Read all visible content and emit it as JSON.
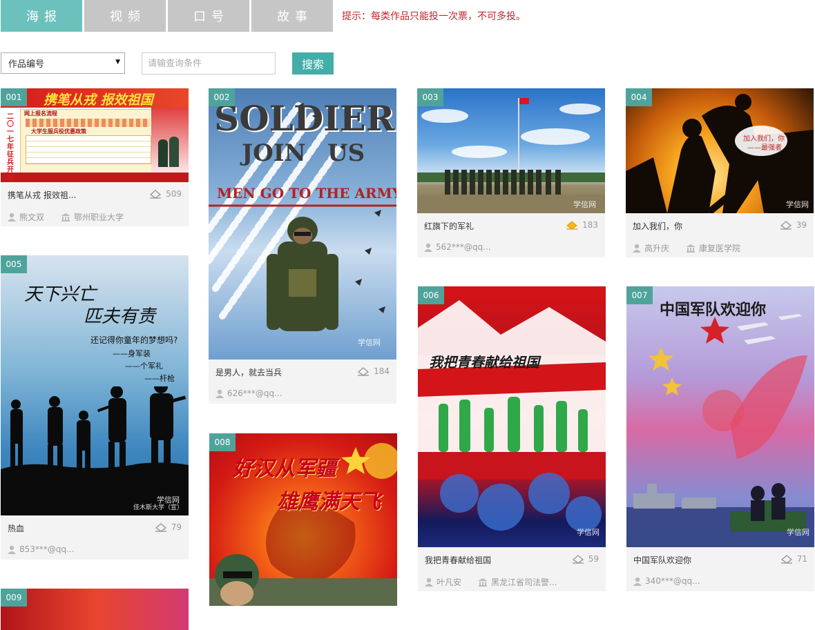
{
  "tabs": [
    {
      "label": "海报",
      "active": true
    },
    {
      "label": "视频",
      "active": false
    },
    {
      "label": "口号",
      "active": false
    },
    {
      "label": "故事",
      "active": false
    }
  ],
  "hint": "提示：每类作品只能投一次票，不可多投。",
  "search": {
    "select_value": "作品编号",
    "placeholder": "请输查询条件",
    "button_label": "搜索"
  },
  "colors": {
    "tab_active": "#6dc1bc",
    "tab_inactive": "#c6c6c6",
    "accent": "#43ada7",
    "hint": "#c0262c",
    "vote_active": "#f2b824"
  },
  "works": [
    {
      "id": "001",
      "title": "携笔从戎 报效祖...",
      "votes": "509",
      "author": "熊文双",
      "school": "鄂州职业大学",
      "poster_text": [
        "携笔从戎 报效祖国",
        "二〇一七年征兵开始了",
        "网上报名流程",
        "大学生服兵役优惠政策"
      ]
    },
    {
      "id": "002",
      "title": "是男人，就去当兵",
      "votes": "184",
      "author": "626***@qq...",
      "school": "",
      "poster_text": [
        "SOLDIER",
        "JOIN",
        "US",
        "MEN GO TO THE ARMY.",
        "学信网"
      ]
    },
    {
      "id": "003",
      "title": "红旗下的军礼",
      "votes": "183",
      "author": "562***@qq...",
      "school": "",
      "poster_text": [
        "学信网"
      ]
    },
    {
      "id": "004",
      "title": "加入我们，你",
      "votes": "39",
      "author": "高升庆",
      "school": "康复医学院",
      "poster_text": [
        "加入我们，你",
        "——最强者",
        "学信网"
      ]
    },
    {
      "id": "005",
      "title": "热血",
      "votes": "79",
      "author": "853***@qq...",
      "school": "",
      "poster_text": [
        "天下兴亡",
        "匹夫有责",
        "还记得你童年的梦想吗?",
        "——身军装",
        "——个军礼",
        "——杆枪",
        "学信网",
        "佳木斯大学（宣）"
      ]
    },
    {
      "id": "006",
      "title": "我把青春献给祖国",
      "votes": "59",
      "author": "叶凡安",
      "school": "黑龙江省司法警...",
      "poster_text": [
        "我把青春献给祖国",
        "学信网"
      ]
    },
    {
      "id": "007",
      "title": "中国军队欢迎你",
      "votes": "71",
      "author": "340***@qq...",
      "school": "",
      "poster_text": [
        "中国军队欢迎你",
        "学信网"
      ]
    },
    {
      "id": "008",
      "title": "",
      "votes": "",
      "author": "",
      "school": "",
      "poster_text": [
        "好汉从军疆",
        "雄鹰满天飞"
      ]
    },
    {
      "id": "009",
      "title": "",
      "votes": "",
      "author": "",
      "school": "",
      "poster_text": []
    }
  ]
}
